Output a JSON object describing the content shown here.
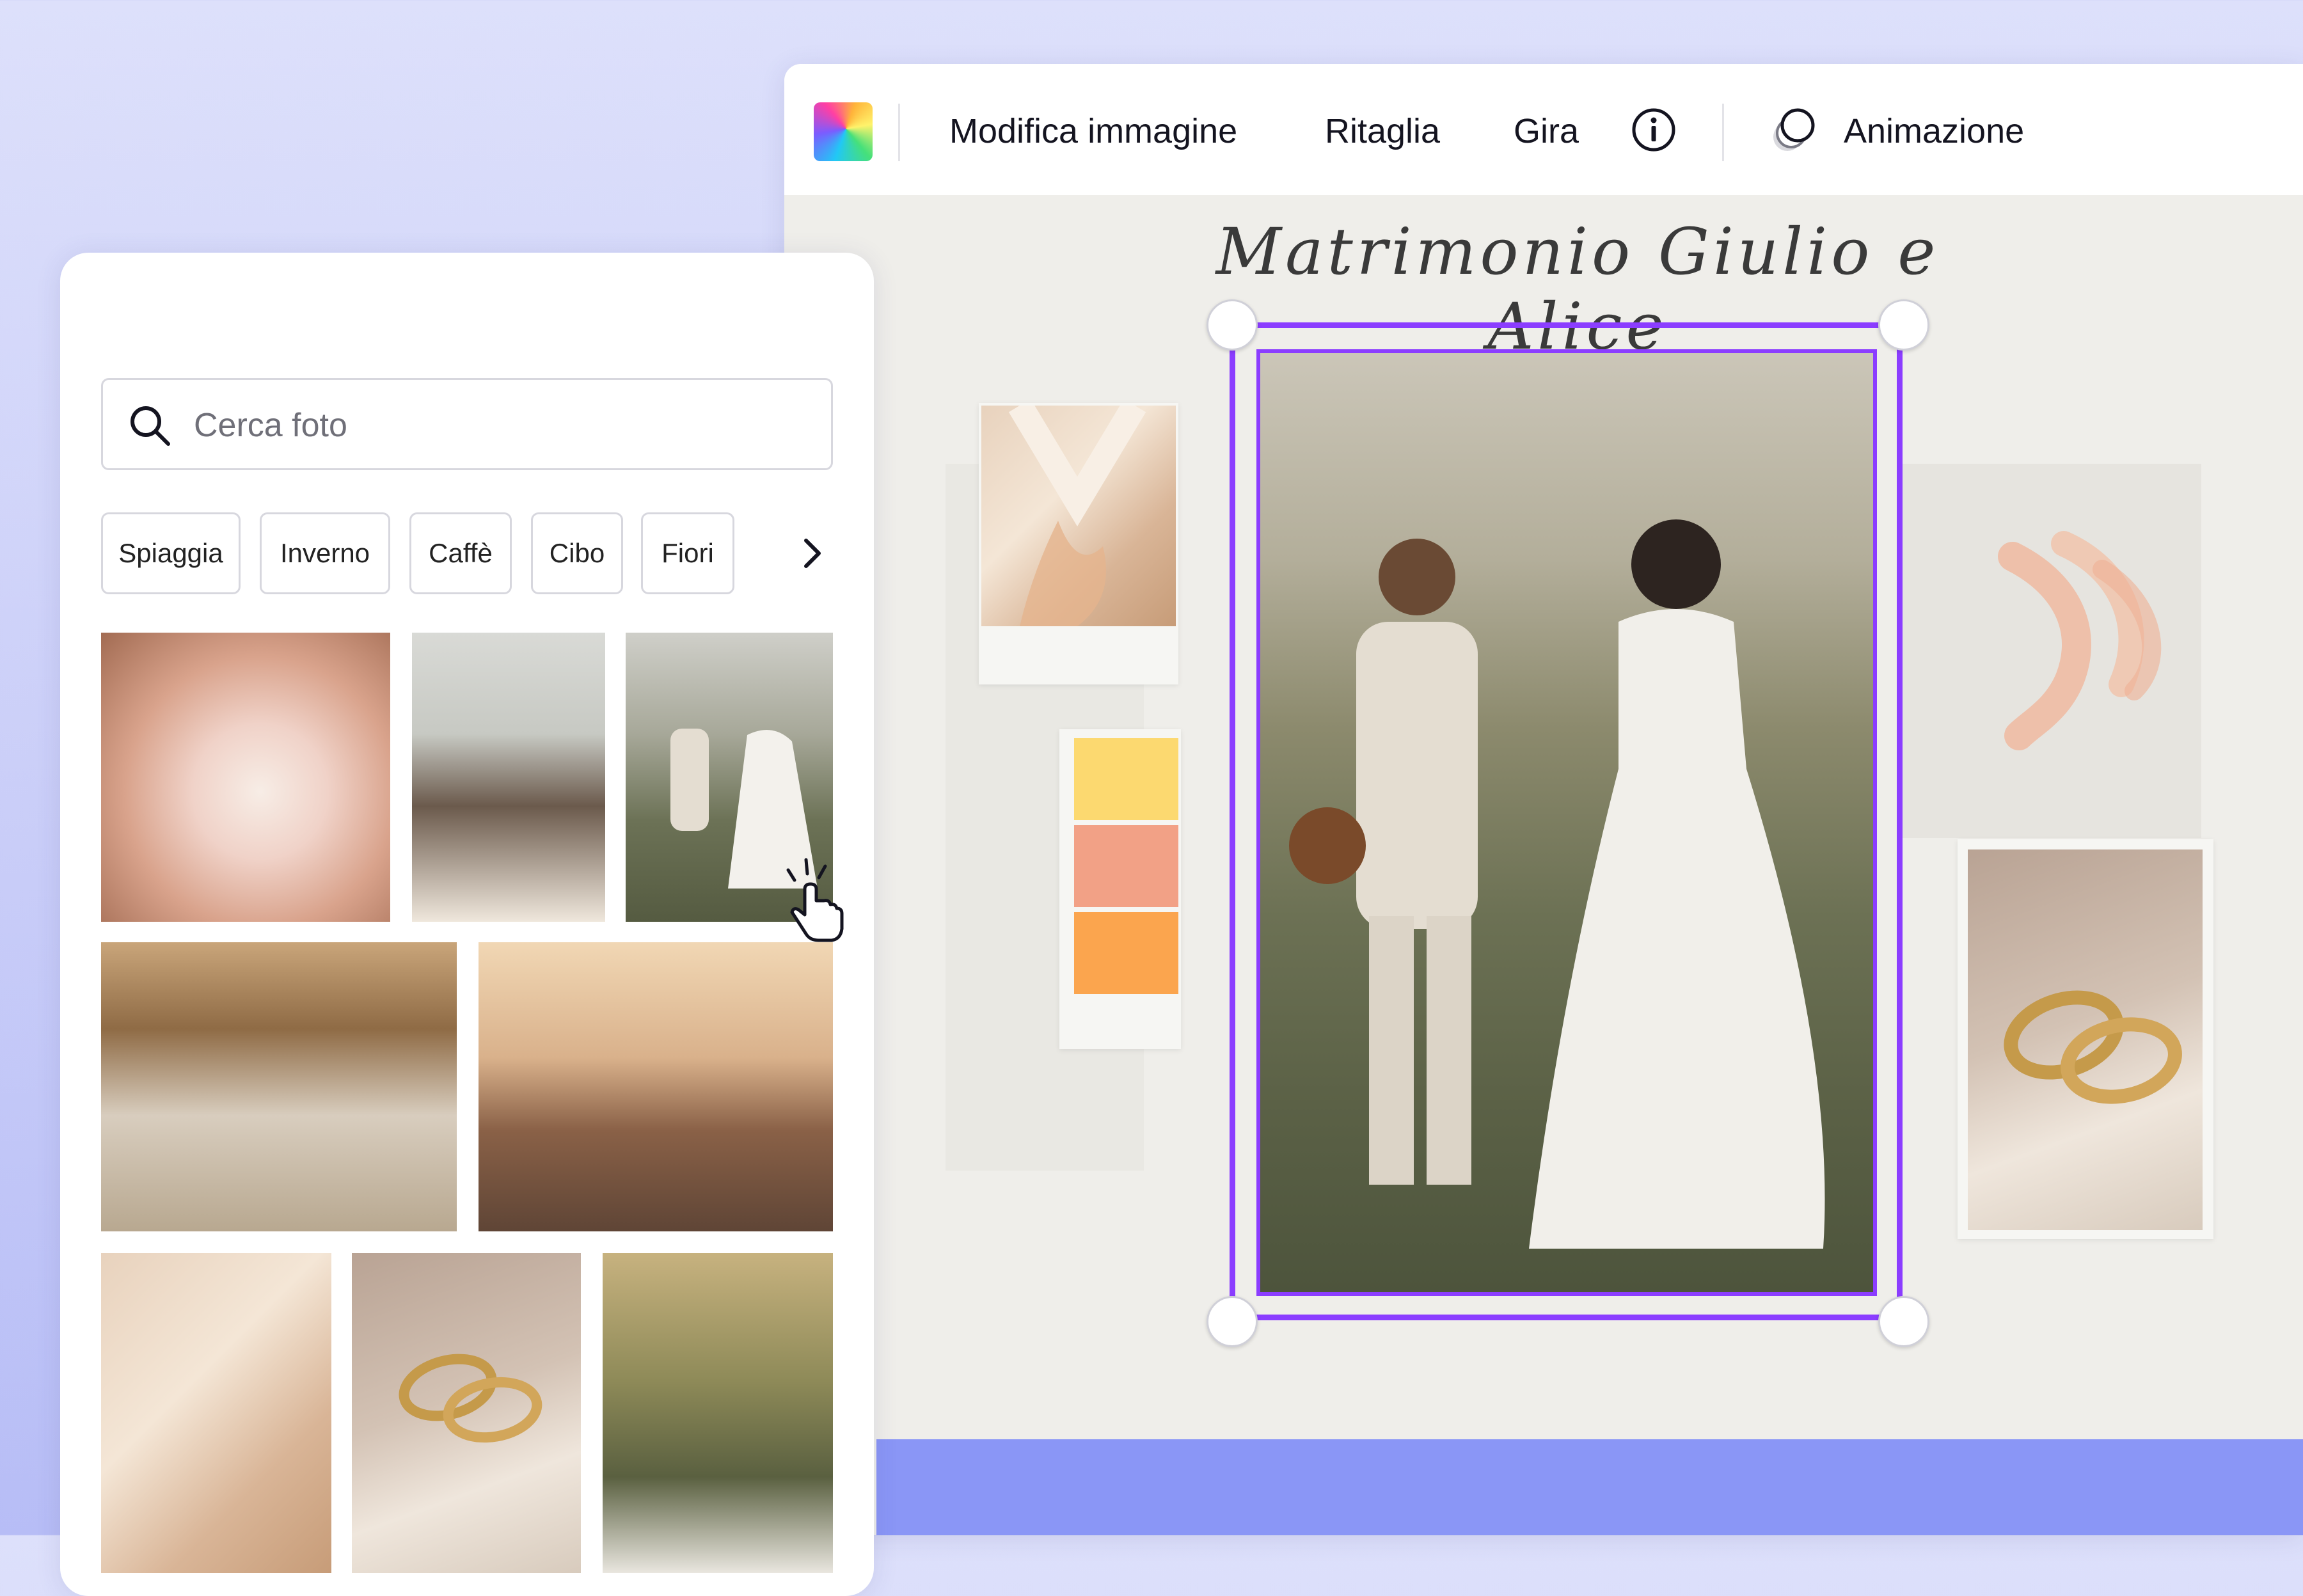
{
  "toolbar": {
    "edit_image": "Modifica immagine",
    "crop": "Ritaglia",
    "rotate": "Gira",
    "animation": "Animazione"
  },
  "canvas": {
    "title": "Matrimonio Giulio e Alice",
    "palette": [
      "#fcd970",
      "#f2a186",
      "#fba54e"
    ],
    "selection_color": "#8b3dff"
  },
  "panel": {
    "search_placeholder": "Cerca foto",
    "chips": [
      "Spiaggia",
      "Inverno",
      "Caffè",
      "Cibo",
      "Fiori"
    ]
  },
  "icons": {
    "app_logo": "app-logo-icon",
    "info": "info-icon",
    "animation": "animation-icon",
    "search": "search-icon",
    "chevron": "chevron-right-icon",
    "cursor": "hand-pointer-icon"
  }
}
